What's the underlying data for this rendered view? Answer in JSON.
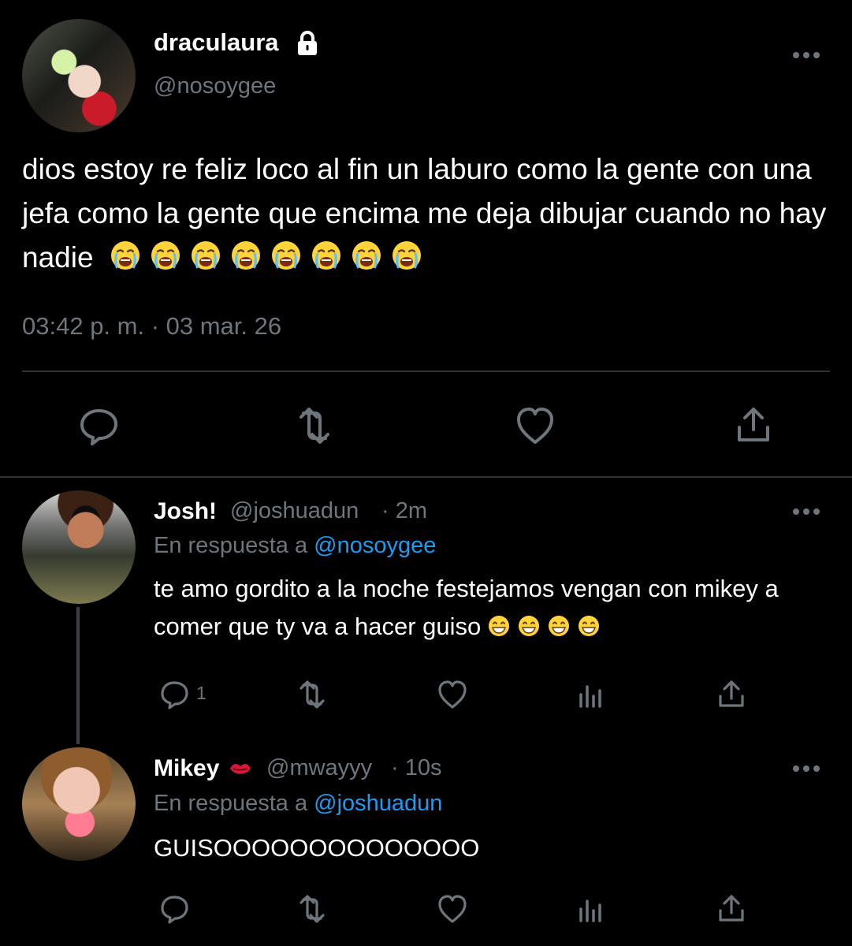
{
  "tweet": {
    "author": {
      "name": "draculaura",
      "handle": "@nosoygee"
    },
    "text": "dios estoy re feliz loco al fin un laburo como la gente con una jefa como la gente que encima me deja dibujar cuando no hay nadie",
    "emoji_count": 8,
    "timestamp": "03:42 p. m. · 03 mar. 26",
    "icons": {
      "lock": "lock-icon",
      "more": "more-icon",
      "reply": "reply-icon",
      "retweet": "retweet-icon",
      "like": "heart-icon",
      "share": "share-icon"
    }
  },
  "replies": [
    {
      "name": "Josh!",
      "handle": "@joshuadun",
      "time": "· 2m",
      "reply_prefix": "En respuesta a",
      "reply_to": "@nosoygee",
      "text": "te amo gordito a la noche festejamos vengan con mikey a comer que ty va a hacer guiso",
      "reply_count": "1",
      "emoji_count": 4
    },
    {
      "name": "Mikey",
      "name_badge": "lips-icon",
      "handle": "@mwayyy",
      "time": "· 10s",
      "reply_prefix": "En respuesta a",
      "reply_to": "@joshuadun",
      "text": "GUISOOOOOOOOOOOOOO"
    }
  ],
  "colors": {
    "background": "#000000",
    "text": "#ffffff",
    "muted": "#6e767d",
    "accent": "#1d9bf0",
    "divider": "#2f3336"
  }
}
